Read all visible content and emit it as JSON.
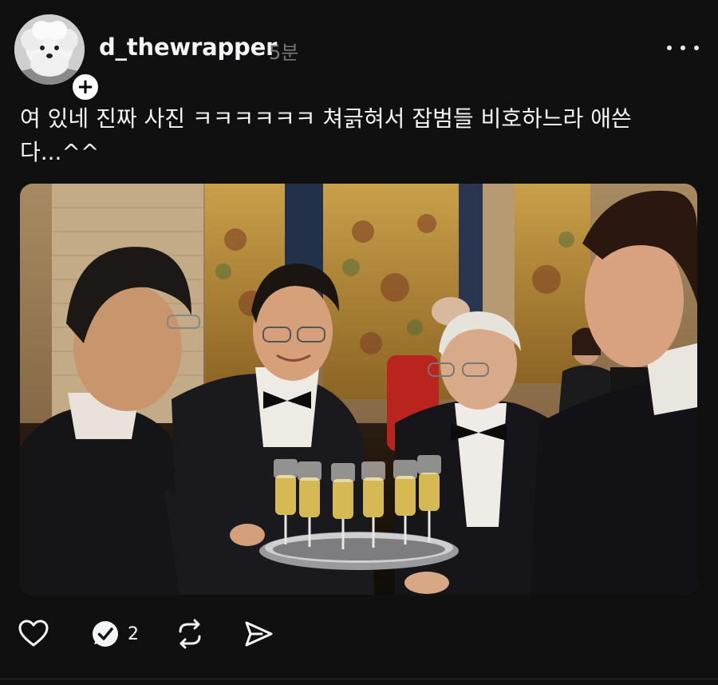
{
  "post": {
    "username": "d_thewrapper",
    "time": "5분",
    "caption": "여 있네 진짜 사진 ㅋㅋㅋㅋㅋㅋ 쳐긁혀서 잡범들 비호하느라 애쓴\n다...^^",
    "follow_symbol": "+"
  },
  "actions": {
    "like_icon": "heart-icon",
    "reply_icon": "comment-icon",
    "reply_count": "2",
    "repost_icon": "repost-icon",
    "share_icon": "send-icon"
  },
  "colors": {
    "background": "#101010",
    "text": "#f3f5f7",
    "muted": "#777777"
  }
}
